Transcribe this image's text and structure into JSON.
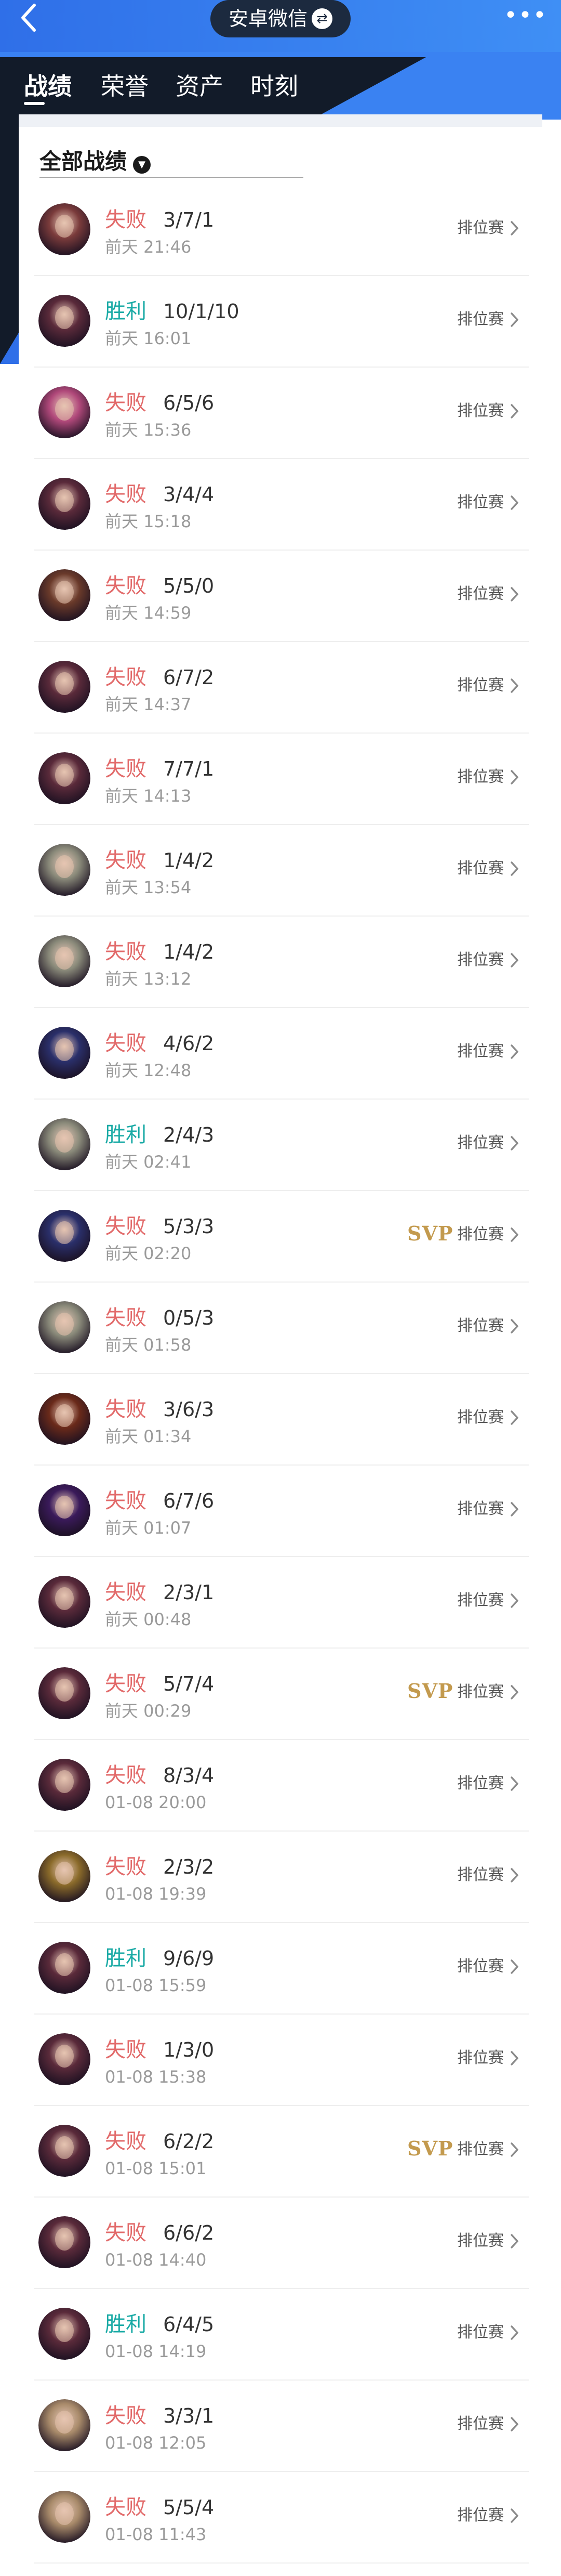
{
  "header": {
    "title": "安卓微信",
    "swap_icon": "⇄",
    "more": "•••",
    "back_icon": "chevron-left-icon"
  },
  "tabs": [
    {
      "label": "战绩",
      "active": true
    },
    {
      "label": "荣誉",
      "active": false
    },
    {
      "label": "资产",
      "active": false
    },
    {
      "label": "时刻",
      "active": false
    }
  ],
  "filter": {
    "label": "全部战绩",
    "caret": "▼"
  },
  "colors": {
    "loss": "#e26b6b",
    "win": "#19aaa5",
    "svp": "#c39a4e",
    "header_blue": "#2f7df0",
    "header_dark": "#121b29"
  },
  "records": [
    {
      "result": "失败",
      "outcome": "loss",
      "kda": "3/7/1",
      "time": "前天 21:46",
      "svp": "",
      "mode": "排位赛",
      "avatar": "#7a3b3b"
    },
    {
      "result": "胜利",
      "outcome": "win",
      "kda": "10/1/10",
      "time": "前天 16:01",
      "svp": "",
      "mode": "排位赛",
      "avatar": "#5a2a3a"
    },
    {
      "result": "失败",
      "outcome": "loss",
      "kda": "6/5/6",
      "time": "前天 15:36",
      "svp": "",
      "mode": "排位赛",
      "avatar": "#b0487a"
    },
    {
      "result": "失败",
      "outcome": "loss",
      "kda": "3/4/4",
      "time": "前天 15:18",
      "svp": "",
      "mode": "排位赛",
      "avatar": "#5a2a3a"
    },
    {
      "result": "失败",
      "outcome": "loss",
      "kda": "5/5/0",
      "time": "前天 14:59",
      "svp": "",
      "mode": "排位赛",
      "avatar": "#6a3a2a"
    },
    {
      "result": "失败",
      "outcome": "loss",
      "kda": "6/7/2",
      "time": "前天 14:37",
      "svp": "",
      "mode": "排位赛",
      "avatar": "#5a2a3a"
    },
    {
      "result": "失败",
      "outcome": "loss",
      "kda": "7/7/1",
      "time": "前天 14:13",
      "svp": "",
      "mode": "排位赛",
      "avatar": "#5a2a3a"
    },
    {
      "result": "失败",
      "outcome": "loss",
      "kda": "1/4/2",
      "time": "前天 13:54",
      "svp": "",
      "mode": "排位赛",
      "avatar": "#8a8a7a"
    },
    {
      "result": "失败",
      "outcome": "loss",
      "kda": "1/4/2",
      "time": "前天 13:12",
      "svp": "",
      "mode": "排位赛",
      "avatar": "#8a8a7a"
    },
    {
      "result": "失败",
      "outcome": "loss",
      "kda": "4/6/2",
      "time": "前天 12:48",
      "svp": "",
      "mode": "排位赛",
      "avatar": "#2a2f6a"
    },
    {
      "result": "胜利",
      "outcome": "win",
      "kda": "2/4/3",
      "time": "前天 02:41",
      "svp": "",
      "mode": "排位赛",
      "avatar": "#8a8a7a"
    },
    {
      "result": "失败",
      "outcome": "loss",
      "kda": "5/3/3",
      "time": "前天 02:20",
      "svp": "SVP",
      "mode": "排位赛",
      "avatar": "#2a2f6a"
    },
    {
      "result": "失败",
      "outcome": "loss",
      "kda": "0/5/3",
      "time": "前天 01:58",
      "svp": "",
      "mode": "排位赛",
      "avatar": "#8a8a7a"
    },
    {
      "result": "失败",
      "outcome": "loss",
      "kda": "3/6/3",
      "time": "前天 01:34",
      "svp": "",
      "mode": "排位赛",
      "avatar": "#6a2a1a"
    },
    {
      "result": "失败",
      "outcome": "loss",
      "kda": "6/7/6",
      "time": "前天 01:07",
      "svp": "",
      "mode": "排位赛",
      "avatar": "#3a1a5a"
    },
    {
      "result": "失败",
      "outcome": "loss",
      "kda": "2/3/1",
      "time": "前天 00:48",
      "svp": "",
      "mode": "排位赛",
      "avatar": "#5a2a3a"
    },
    {
      "result": "失败",
      "outcome": "loss",
      "kda": "5/7/4",
      "time": "前天 00:29",
      "svp": "SVP",
      "mode": "排位赛",
      "avatar": "#5a2a3a"
    },
    {
      "result": "失败",
      "outcome": "loss",
      "kda": "8/3/4",
      "time": "01-08 20:00",
      "svp": "",
      "mode": "排位赛",
      "avatar": "#5a2a3a"
    },
    {
      "result": "失败",
      "outcome": "loss",
      "kda": "2/3/2",
      "time": "01-08 19:39",
      "svp": "",
      "mode": "排位赛",
      "avatar": "#8a6a2a"
    },
    {
      "result": "胜利",
      "outcome": "win",
      "kda": "9/6/9",
      "time": "01-08 15:59",
      "svp": "",
      "mode": "排位赛",
      "avatar": "#5a2a3a"
    },
    {
      "result": "失败",
      "outcome": "loss",
      "kda": "1/3/0",
      "time": "01-08 15:38",
      "svp": "",
      "mode": "排位赛",
      "avatar": "#5a2a3a"
    },
    {
      "result": "失败",
      "outcome": "loss",
      "kda": "6/2/2",
      "time": "01-08 15:01",
      "svp": "SVP",
      "mode": "排位赛",
      "avatar": "#5a2a3a"
    },
    {
      "result": "失败",
      "outcome": "loss",
      "kda": "6/6/2",
      "time": "01-08 14:40",
      "svp": "",
      "mode": "排位赛",
      "avatar": "#5a2a3a"
    },
    {
      "result": "胜利",
      "outcome": "win",
      "kda": "6/4/5",
      "time": "01-08 14:19",
      "svp": "",
      "mode": "排位赛",
      "avatar": "#5a2a3a"
    },
    {
      "result": "失败",
      "outcome": "loss",
      "kda": "3/3/1",
      "time": "01-08 12:05",
      "svp": "",
      "mode": "排位赛",
      "avatar": "#a88a6a"
    },
    {
      "result": "失败",
      "outcome": "loss",
      "kda": "5/5/4",
      "time": "01-08 11:43",
      "svp": "",
      "mode": "排位赛",
      "avatar": "#a88a6a"
    }
  ]
}
